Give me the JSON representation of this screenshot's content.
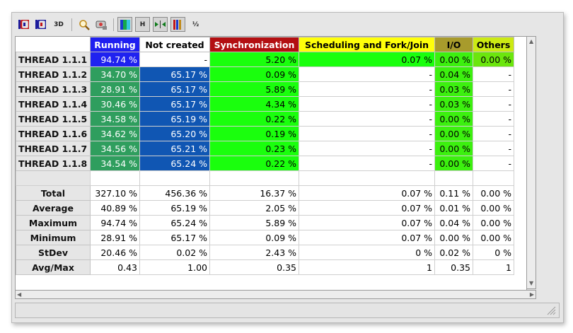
{
  "toolbar": {
    "buttons": [
      {
        "name": "color-view-icon",
        "label": "",
        "pressed": false
      },
      {
        "name": "id-view-icon",
        "label": "",
        "pressed": false
      },
      {
        "name": "3d-view-icon",
        "label": "3D",
        "pressed": false
      },
      {
        "name": "zoom-icon",
        "label": "",
        "pressed": false
      },
      {
        "name": "settings-icon",
        "label": "",
        "pressed": false
      },
      {
        "name": "gradient-color-icon",
        "label": "",
        "pressed": true
      },
      {
        "name": "horizontal-icon",
        "label": "H",
        "pressed": true
      },
      {
        "name": "arrows-icon",
        "label": "",
        "pressed": true
      },
      {
        "name": "columns-icon",
        "label": "",
        "pressed": true
      },
      {
        "name": "fraction-icon",
        "label": "½",
        "pressed": false
      }
    ]
  },
  "columns": [
    {
      "label": "Running",
      "bg": "#1f1ff0",
      "color": "#ffffff"
    },
    {
      "label": "Not created",
      "bg": "#ffffff",
      "color": "#000000"
    },
    {
      "label": "Synchronization",
      "bg": "#b30f12",
      "color": "#ffffff"
    },
    {
      "label": "Scheduling and Fork/Join",
      "bg": "#ffff0a",
      "color": "#000000"
    },
    {
      "label": "I/O",
      "bg": "#a89b2c",
      "color": "#000000"
    },
    {
      "label": "Others",
      "bg": "#ccea13",
      "color": "#000000"
    }
  ],
  "threads": [
    {
      "name": "THREAD 1.1.1",
      "values": [
        "94.74 %",
        "-",
        "5.20 %",
        "0.07 %",
        "0.00 %",
        "0.00 %"
      ]
    },
    {
      "name": "THREAD 1.1.2",
      "values": [
        "34.70 %",
        "65.17 %",
        "0.09 %",
        "-",
        "0.04 %",
        "-"
      ]
    },
    {
      "name": "THREAD 1.1.3",
      "values": [
        "28.91 %",
        "65.17 %",
        "5.89 %",
        "-",
        "0.03 %",
        "-"
      ]
    },
    {
      "name": "THREAD 1.1.4",
      "values": [
        "30.46 %",
        "65.17 %",
        "4.34 %",
        "-",
        "0.03 %",
        "-"
      ]
    },
    {
      "name": "THREAD 1.1.5",
      "values": [
        "34.58 %",
        "65.19 %",
        "0.22 %",
        "-",
        "0.00 %",
        "-"
      ]
    },
    {
      "name": "THREAD 1.1.6",
      "values": [
        "34.62 %",
        "65.20 %",
        "0.19 %",
        "-",
        "0.00 %",
        "-"
      ]
    },
    {
      "name": "THREAD 1.1.7",
      "values": [
        "34.56 %",
        "65.21 %",
        "0.23 %",
        "-",
        "0.00 %",
        "-"
      ]
    },
    {
      "name": "THREAD 1.1.8",
      "values": [
        "34.54 %",
        "65.24 %",
        "0.22 %",
        "-",
        "0.00 %",
        "-"
      ]
    }
  ],
  "stats": [
    {
      "name": "Total",
      "values": [
        "327.10 %",
        "456.36 %",
        "16.37 %",
        "0.07 %",
        "0.11 %",
        "0.00 %"
      ]
    },
    {
      "name": "Average",
      "values": [
        "40.89 %",
        "65.19 %",
        "2.05 %",
        "0.07 %",
        "0.01 %",
        "0.00 %"
      ]
    },
    {
      "name": "Maximum",
      "values": [
        "94.74 %",
        "65.24 %",
        "5.89 %",
        "0.07 %",
        "0.04 %",
        "0.00 %"
      ]
    },
    {
      "name": "Minimum",
      "values": [
        "28.91 %",
        "65.17 %",
        "0.09 %",
        "0.07 %",
        "0.00 %",
        "0.00 %"
      ]
    },
    {
      "name": "StDev",
      "values": [
        "20.46 %",
        "0.02 %",
        "2.43 %",
        "0 %",
        "0.02 %",
        "0 %"
      ]
    },
    {
      "name": "Avg/Max",
      "values": [
        "0.43",
        "1.00",
        "0.35",
        "1",
        "0.35",
        "1"
      ]
    }
  ]
}
